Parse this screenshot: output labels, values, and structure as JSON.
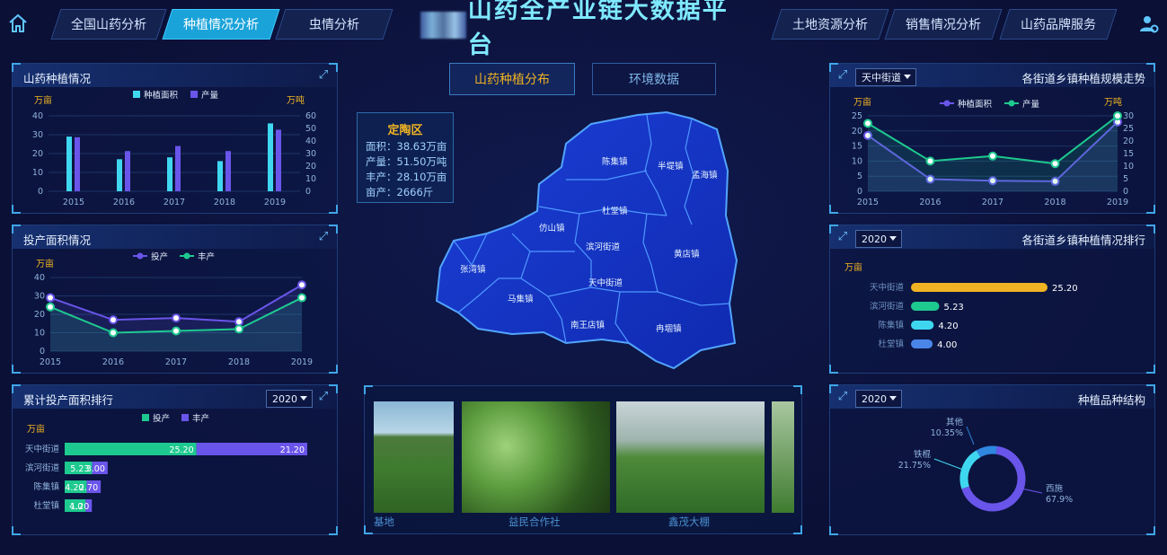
{
  "nav": {
    "left": [
      "全国山药分析",
      "种植情况分析",
      "虫情分析"
    ],
    "right": [
      "土地资源分析",
      "销售情况分析",
      "山药品牌服务"
    ],
    "active": "种植情况分析"
  },
  "title": "山药全产业链大数据平台",
  "panels": {
    "planting": {
      "title": "山药种植情况",
      "unit_left": "万亩",
      "unit_right": "万吨",
      "legend": [
        "种植面积",
        "产量"
      ]
    },
    "invest": {
      "title": "投产面积情况",
      "unit": "万亩",
      "legend": [
        "投产",
        "丰产"
      ]
    },
    "ranking": {
      "title": "累计投产面积排行",
      "select": "2020",
      "unit": "万亩",
      "legend": [
        "投产",
        "丰产"
      ]
    },
    "trend": {
      "select": "天中街道",
      "title": "各街道乡镇种植规模走势",
      "unit_left": "万亩",
      "unit_right": "万吨",
      "legend": [
        "种植面积",
        "产量"
      ]
    },
    "town_rank": {
      "select": "2020",
      "title": "各街道乡镇种植情况排行",
      "unit": "万亩"
    },
    "variety": {
      "select": "2020",
      "title": "种植品种结构"
    }
  },
  "center_tabs": [
    "山药种植分布",
    "环境数据"
  ],
  "info_box": {
    "title": "定陶区",
    "lines": [
      "面积：38.63万亩",
      "产量：51.50万吨",
      "丰产：28.10万亩",
      "亩产：2666斤"
    ]
  },
  "map_towns": [
    "陈集镇",
    "半堤镇",
    "孟海镇",
    "仿山镇",
    "杜堂镇",
    "滨河街道",
    "张湾镇",
    "黄店镇",
    "天中街道",
    "马集镇",
    "南王店镇",
    "冉堌镇"
  ],
  "photos": [
    "基地",
    "益民合作社",
    "鑫茂大棚"
  ],
  "colors": {
    "bg": "#0b1036",
    "accent": "#1aa3d9",
    "purple": "#6a55ea",
    "green": "#1ec98f",
    "cyan": "#3fd7f0",
    "orange": "#f0b323"
  },
  "chart_data": [
    {
      "type": "bar",
      "title": "山药种植情况",
      "categories": [
        "2015",
        "2016",
        "2017",
        "2018",
        "2019"
      ],
      "series": [
        {
          "name": "种植面积",
          "axis": "left",
          "values": [
            29,
            17,
            18,
            16,
            36
          ]
        },
        {
          "name": "产量",
          "axis": "right",
          "values": [
            43,
            32,
            36,
            32,
            49
          ]
        }
      ],
      "ylim_left": [
        0,
        40
      ],
      "yticks_left": [
        0,
        10,
        20,
        30,
        40
      ],
      "ylim_right": [
        0,
        60
      ],
      "yticks_right": [
        0,
        10,
        20,
        30,
        40,
        50,
        60
      ]
    },
    {
      "type": "line",
      "title": "投产面积情况",
      "categories": [
        "2015",
        "2016",
        "2017",
        "2018",
        "2019"
      ],
      "series": [
        {
          "name": "投产",
          "values": [
            29,
            17,
            18,
            16,
            36
          ]
        },
        {
          "name": "丰产",
          "values": [
            24,
            10,
            11,
            12,
            29
          ]
        }
      ],
      "ylim": [
        0,
        40
      ],
      "yticks": [
        0,
        10,
        20,
        30,
        40
      ]
    },
    {
      "type": "bar",
      "title": "累计投产面积排行",
      "orientation": "horizontal-stacked",
      "categories": [
        "天中街道",
        "滨河街道",
        "陈集镇",
        "杜堂镇"
      ],
      "series": [
        {
          "name": "投产",
          "values": [
            25.2,
            5.23,
            4.2,
            4.0
          ]
        },
        {
          "name": "丰产",
          "values": [
            21.2,
            3.0,
            2.7,
            1.2
          ]
        }
      ],
      "labels": {
        "投产": [
          "25.20",
          "5.23",
          "4.20",
          "4.0"
        ],
        "丰产": [
          "21.20",
          "3.00",
          "2.70",
          "1.20"
        ]
      }
    },
    {
      "type": "line",
      "title": "各街道乡镇种植规模走势",
      "categories": [
        "2015",
        "2016",
        "2017",
        "2018",
        "2019"
      ],
      "series": [
        {
          "name": "种植面积",
          "axis": "left",
          "values": [
            18.5,
            4,
            3.5,
            3.3,
            23
          ]
        },
        {
          "name": "产量",
          "axis": "right",
          "values": [
            27,
            12,
            14,
            11,
            30
          ]
        }
      ],
      "ylim_left": [
        0,
        25
      ],
      "yticks_left": [
        0,
        5,
        10,
        15,
        20,
        25
      ],
      "ylim_right": [
        0,
        30
      ],
      "yticks_right": [
        0,
        5,
        10,
        15,
        20,
        25,
        30
      ]
    },
    {
      "type": "bar",
      "title": "各街道乡镇种植情况排行",
      "orientation": "horizontal",
      "categories": [
        "天中街道",
        "滨河街道",
        "陈集镇",
        "杜堂镇"
      ],
      "values": [
        25.2,
        5.23,
        4.2,
        4.0
      ],
      "labels": [
        "25.20",
        "5.23",
        "4.20",
        "4.00"
      ]
    },
    {
      "type": "pie",
      "title": "种植品种结构",
      "slices": [
        {
          "name": "西施",
          "value": 67.9,
          "label": "67.9%"
        },
        {
          "name": "铁棍",
          "value": 21.75,
          "label": "21.75%"
        },
        {
          "name": "其他",
          "value": 10.35,
          "label": "10.35%"
        }
      ]
    }
  ]
}
